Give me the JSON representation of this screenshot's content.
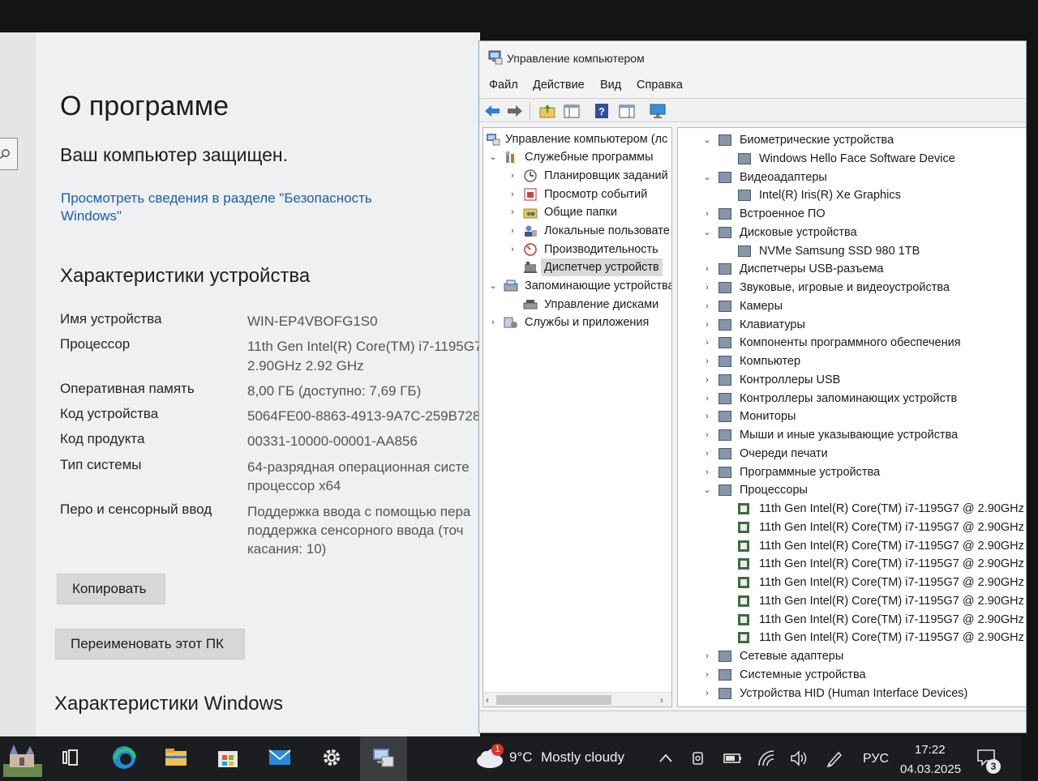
{
  "about": {
    "title": "О программе",
    "protected_text": "Ваш компьютер защищен.",
    "security_link": "Просмотреть сведения в разделе \"Безопасность Windows\"",
    "device_specs_heading": "Характеристики устройства",
    "specs": [
      {
        "label": "Имя устройства",
        "value": "WIN-EP4VBOFG1S0",
        "value2": ""
      },
      {
        "label": "Процессор",
        "value": "11th Gen Intel(R) Core(TM) i7-1195G7",
        "value2": "2.90GHz   2.92 GHz"
      },
      {
        "label": "Оперативная память",
        "value": "8,00 ГБ (доступно: 7,69 ГБ)",
        "value2": ""
      },
      {
        "label": "Код устройства",
        "value": "5064FE00-8863-4913-9A7C-259B728",
        "value2": ""
      },
      {
        "label": "Код продукта",
        "value": "00331-10000-00001-AA856",
        "value2": ""
      },
      {
        "label": "Тип системы",
        "value": "64-разрядная операционная систе",
        "value2": "процессор x64"
      },
      {
        "label": "Перо и сенсорный ввод",
        "value": "Поддержка ввода с помощью пера",
        "value2": "поддержка сенсорного ввода (точ",
        "value3": "касания: 10)"
      }
    ],
    "copy_button": "Копировать",
    "rename_button": "Переименовать этот ПК",
    "windows_specs_heading": "Характеристики Windows"
  },
  "compmgmt": {
    "title": "Управление компьютером",
    "menu": [
      "Файл",
      "Действие",
      "Вид",
      "Справка"
    ],
    "tree": [
      {
        "label": "Управление компьютером (лс",
        "icon": "computer-management-icon"
      },
      {
        "label": "Служебные программы",
        "icon": "system-tools-icon"
      },
      {
        "label": "Планировщик заданий",
        "icon": "task-scheduler-icon"
      },
      {
        "label": "Просмотр событий",
        "icon": "event-viewer-icon"
      },
      {
        "label": "Общие папки",
        "icon": "shared-folders-icon"
      },
      {
        "label": "Локальные пользовате",
        "icon": "local-users-icon"
      },
      {
        "label": "Производительность",
        "icon": "performance-icon"
      },
      {
        "label": "Диспетчер устройств",
        "icon": "device-manager-icon",
        "selected": true
      },
      {
        "label": "Запоминающие устройства",
        "icon": "storage-icon"
      },
      {
        "label": "Управление дисками",
        "icon": "disk-management-icon"
      },
      {
        "label": "Службы и приложения",
        "icon": "services-icon"
      }
    ],
    "devices": [
      {
        "label": "Биометрические устройства",
        "expanded": true
      },
      {
        "label": "Windows Hello Face Software Device",
        "child": true
      },
      {
        "label": "Видеоадаптеры",
        "expanded": true
      },
      {
        "label": "Intel(R) Iris(R) Xe Graphics",
        "child": true
      },
      {
        "label": "Встроенное ПО"
      },
      {
        "label": "Дисковые устройства",
        "expanded": true
      },
      {
        "label": "NVMe Samsung SSD 980 1TB",
        "child": true
      },
      {
        "label": "Диспетчеры USB-разъема"
      },
      {
        "label": "Звуковые, игровые и видеоустройства"
      },
      {
        "label": "Камеры"
      },
      {
        "label": "Клавиатуры"
      },
      {
        "label": "Компоненты программного обеспечения"
      },
      {
        "label": "Компьютер"
      },
      {
        "label": "Контроллеры USB"
      },
      {
        "label": "Контроллеры запоминающих устройств"
      },
      {
        "label": "Мониторы"
      },
      {
        "label": "Мыши и иные указывающие устройства"
      },
      {
        "label": "Очереди печати"
      },
      {
        "label": "Программные устройства"
      },
      {
        "label": "Процессоры",
        "expanded": true
      },
      {
        "label": "11th Gen Intel(R) Core(TM) i7-1195G7 @ 2.90GHz",
        "child": true
      },
      {
        "label": "11th Gen Intel(R) Core(TM) i7-1195G7 @ 2.90GHz",
        "child": true
      },
      {
        "label": "11th Gen Intel(R) Core(TM) i7-1195G7 @ 2.90GHz",
        "child": true
      },
      {
        "label": "11th Gen Intel(R) Core(TM) i7-1195G7 @ 2.90GHz",
        "child": true
      },
      {
        "label": "11th Gen Intel(R) Core(TM) i7-1195G7 @ 2.90GHz",
        "child": true
      },
      {
        "label": "11th Gen Intel(R) Core(TM) i7-1195G7 @ 2.90GHz",
        "child": true
      },
      {
        "label": "11th Gen Intel(R) Core(TM) i7-1195G7 @ 2.90GHz",
        "child": true
      },
      {
        "label": "11th Gen Intel(R) Core(TM) i7-1195G7 @ 2.90GHz",
        "child": true
      },
      {
        "label": "Сетевые адаптеры"
      },
      {
        "label": "Системные устройства"
      },
      {
        "label": "Устройства HID (Human Interface Devices)"
      }
    ]
  },
  "taskbar": {
    "weather_temp": "9°C",
    "weather_text": "Mostly cloudy",
    "weather_badge": "1",
    "language": "РУС",
    "time": "17:22",
    "date": "04.03.2025",
    "notification_count": "3",
    "apps": [
      "task-view-icon",
      "edge-icon",
      "file-explorer-icon",
      "store-icon",
      "mail-icon",
      "settings-icon",
      "computer-management-icon"
    ]
  },
  "colors": {
    "link": "#1a5fb4",
    "taskbar": "#1c1d20",
    "settings_bg": "#eef0f1"
  }
}
